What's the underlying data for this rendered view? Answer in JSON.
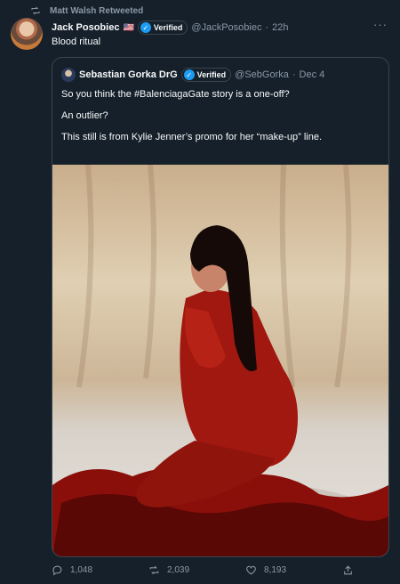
{
  "retweet_banner": "Matt Walsh Retweeted",
  "tweet": {
    "author_name": "Jack Posobiec",
    "author_flag": "🇺🇸",
    "verified_label": "Verified",
    "handle": "@JackPosobiec",
    "separator": "·",
    "time": "22h",
    "text": "Blood ritual"
  },
  "quoted_tweet": {
    "author_name": "Sebastian Gorka DrG",
    "verified_label": "Verified",
    "handle": "@SebGorka",
    "separator": "·",
    "date": "Dec 4",
    "paragraphs": [
      "So you think the #BalenciagaGate story is a one-off?",
      "An outlier?",
      "This still is from Kylie Jenner’s promo for her “make-up” line."
    ]
  },
  "actions": {
    "replies": "1,048",
    "retweets": "2,039",
    "likes": "8,193"
  },
  "colors": {
    "background": "#15202b",
    "border": "#38444d",
    "muted": "#8b98a5",
    "verified": "#1d9bf0"
  },
  "icons": [
    "retweet-icon",
    "verified-icon",
    "more-icon",
    "reply-icon",
    "like-icon",
    "share-icon"
  ]
}
